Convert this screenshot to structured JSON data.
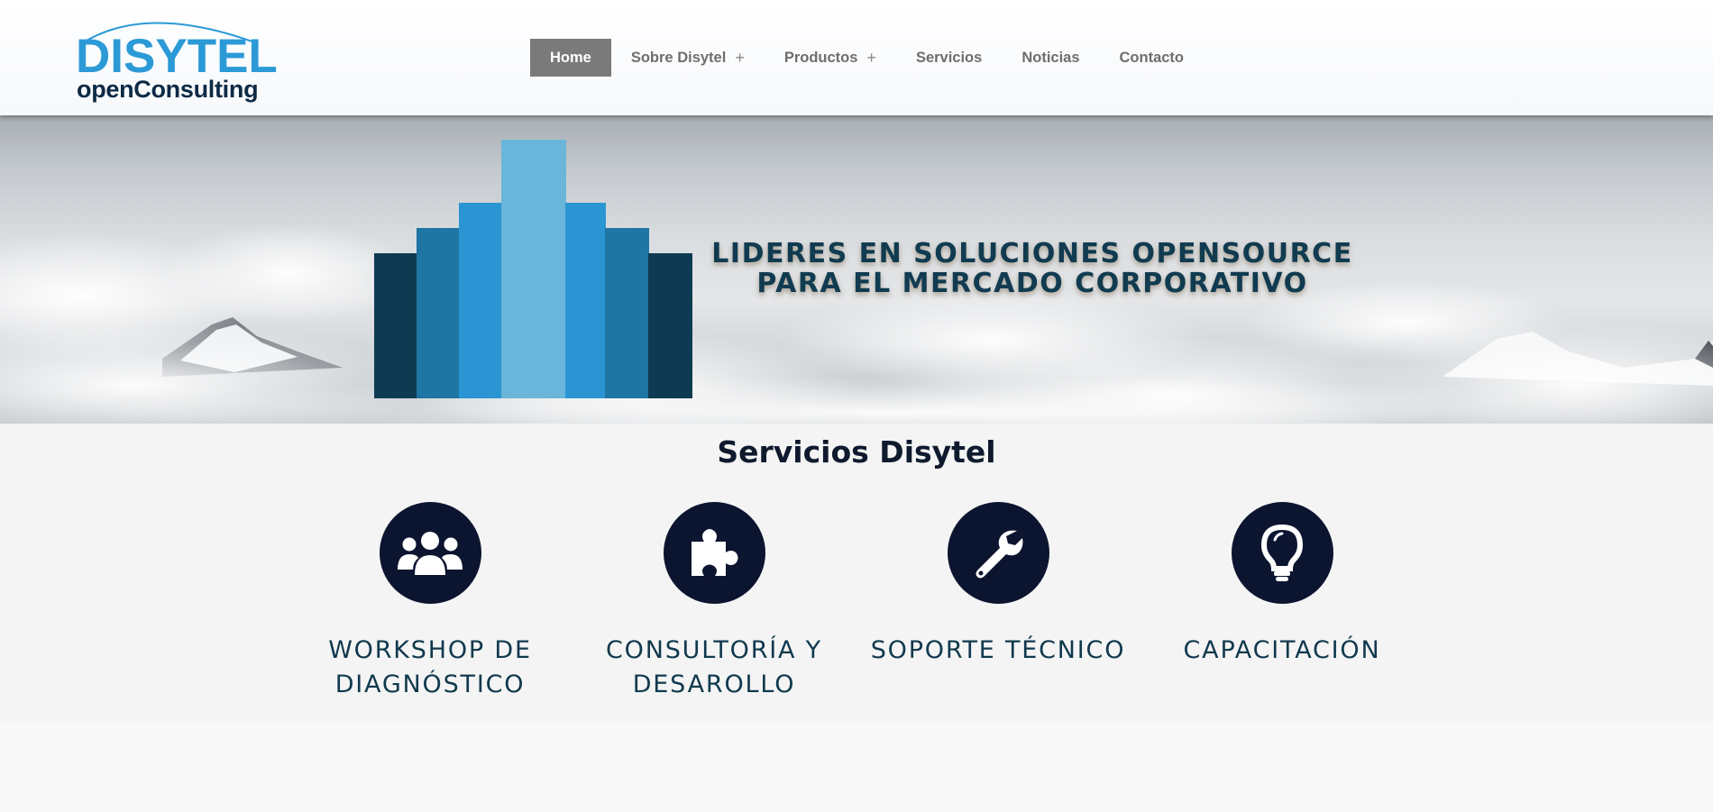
{
  "logo": {
    "top": "DISYTEL",
    "bottom": "openConsulting"
  },
  "nav": {
    "items": [
      {
        "label": "Home"
      },
      {
        "label": "Sobre Disytel",
        "expand_icon": "+"
      },
      {
        "label": "Productos",
        "expand_icon": "+"
      },
      {
        "label": "Servicios"
      },
      {
        "label": "Noticias"
      },
      {
        "label": "Contacto"
      }
    ]
  },
  "hero": {
    "line1": "LIDERES EN SOLUCIONES OPENSOURCE",
    "line2": "PARA EL MERCADO CORPORATIVO"
  },
  "services": {
    "title": "Servicios Disytel",
    "items": [
      {
        "icon": "users-icon",
        "line1": "WORKSHOP DE",
        "line2": "DIAGNÓSTICO"
      },
      {
        "icon": "puzzle-icon",
        "line1": "CONSULTORÍA Y",
        "line2": "DESAROLLO"
      },
      {
        "icon": "wrench-icon",
        "line1": "SOPORTE TÉCNICO",
        "line2": ""
      },
      {
        "icon": "lightbulb-icon",
        "line1": "CAPACITACIÓN",
        "line2": ""
      }
    ]
  },
  "colors": {
    "brand_blue": "#2b9ad6",
    "brand_dark": "#0d2a45",
    "icon_circle": "#0c1530",
    "nav_active_bg": "#7a7a7a"
  }
}
